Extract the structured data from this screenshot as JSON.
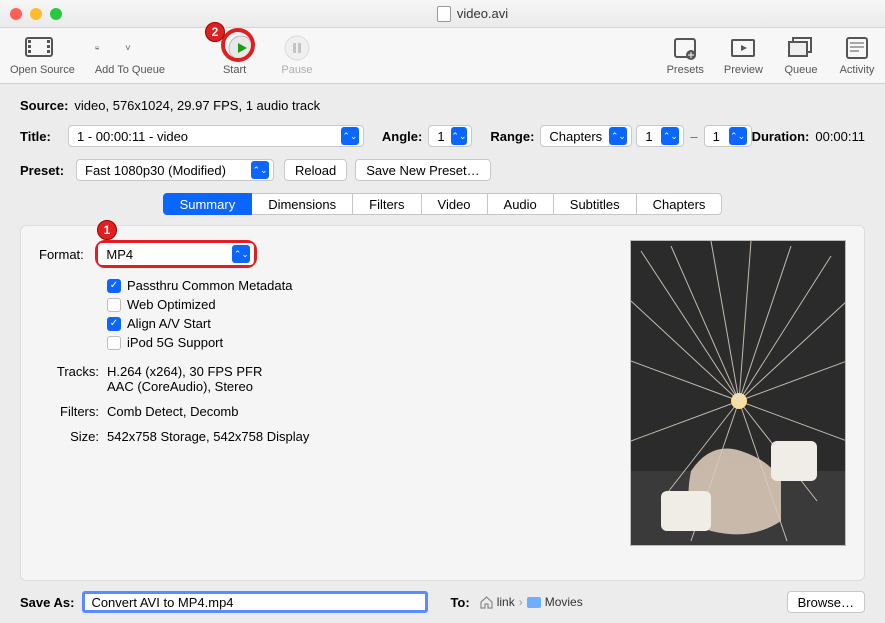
{
  "window": {
    "title": "video.avi"
  },
  "toolbar": {
    "open_source": "Open Source",
    "add_to_queue": "Add To Queue",
    "start": "Start",
    "pause": "Pause",
    "presets": "Presets",
    "preview": "Preview",
    "queue": "Queue",
    "activity": "Activity"
  },
  "source": {
    "label": "Source:",
    "value": "video, 576x1024, 29.97 FPS, 1 audio track"
  },
  "title": {
    "label": "Title:",
    "value": "1 - 00:00:11 - video"
  },
  "angle": {
    "label": "Angle:",
    "value": "1"
  },
  "range": {
    "label": "Range:",
    "type": "Chapters",
    "from": "1",
    "to": "1",
    "dash": "–"
  },
  "duration": {
    "label": "Duration:",
    "value": "00:00:11"
  },
  "preset": {
    "label": "Preset:",
    "value": "Fast 1080p30 (Modified)",
    "reload": "Reload",
    "savenew": "Save New Preset…"
  },
  "tabs": {
    "summary": "Summary",
    "dimensions": "Dimensions",
    "filters": "Filters",
    "video": "Video",
    "audio": "Audio",
    "subtitles": "Subtitles",
    "chapters": "Chapters"
  },
  "summary": {
    "format_label": "Format:",
    "format_value": "MP4",
    "passthru": "Passthru Common Metadata",
    "webopt": "Web Optimized",
    "align": "Align A/V Start",
    "ipod": "iPod 5G Support",
    "tracks_label": "Tracks:",
    "tracks_line1": "H.264 (x264), 30 FPS PFR",
    "tracks_line2": "AAC (CoreAudio), Stereo",
    "filters_label": "Filters:",
    "filters_value": "Comb Detect, Decomb",
    "size_label": "Size:",
    "size_value": "542x758 Storage, 542x758 Display"
  },
  "saveas": {
    "label": "Save As:",
    "value": "Convert AVI to MP4.mp4"
  },
  "to": {
    "label": "To:",
    "path1": "link",
    "path2": "Movies",
    "sep": "›",
    "browse": "Browse…"
  },
  "badges": {
    "b1": "1",
    "b2": "2"
  }
}
